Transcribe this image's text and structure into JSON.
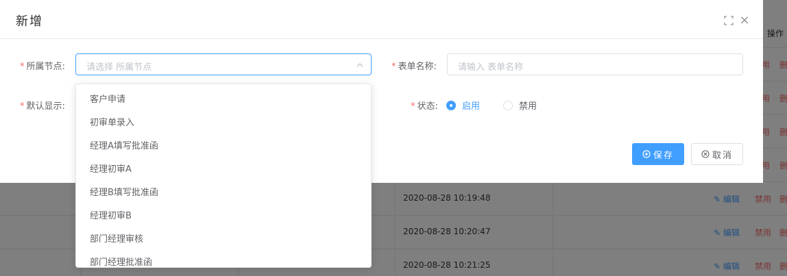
{
  "background": {
    "header_action": "操作",
    "side_rows": [
      {
        "disable": "用",
        "delete": "删"
      },
      {
        "disable": "用",
        "delete": "删"
      },
      {
        "disable": "用",
        "delete": "删"
      },
      {
        "disable": "用",
        "delete": "删"
      }
    ],
    "rows": [
      {
        "time": "2020-08-28 10:19:48",
        "edit": "编辑",
        "disable": "禁用",
        "delete": "删"
      },
      {
        "time": "2020-08-28 10:20:47",
        "edit": "编辑",
        "disable": "禁用",
        "delete": "删"
      },
      {
        "time": "2020-08-28 10:21:25",
        "edit": "编辑",
        "disable": "禁用",
        "delete": "删"
      }
    ]
  },
  "dialog": {
    "title": "新增",
    "form": {
      "node_label": "所属节点:",
      "node_placeholder": "请选择 所属节点",
      "form_name_label": "表单名称:",
      "form_name_placeholder": "请输入 表单名称",
      "default_show_label": "默认显示:",
      "status_label": "状态:",
      "status_options": [
        "启用",
        "禁用"
      ],
      "status_selected": "启用"
    },
    "save_label": "保存",
    "cancel_label": "取消"
  },
  "dropdown": {
    "options": [
      "客户申请",
      "初审单录入",
      "经理A填写批准函",
      "经理初审A",
      "经理B填写批准函",
      "经理初审B",
      "部门经理审核",
      "部门经理批准函"
    ]
  },
  "colors": {
    "primary": "#409eff",
    "danger": "#f56c6c",
    "mask": "rgba(0,0,0,0.5)"
  }
}
